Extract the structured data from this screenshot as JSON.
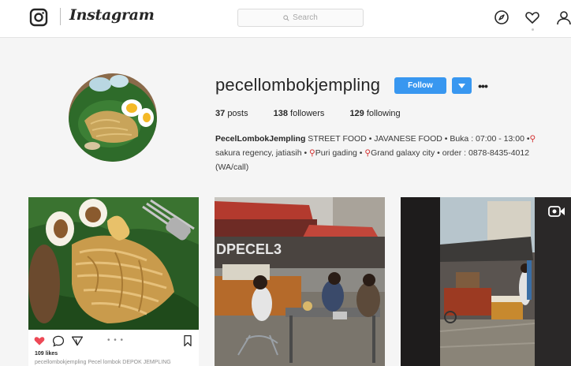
{
  "header": {
    "wordmark": "Instagram",
    "search_placeholder": "Search"
  },
  "profile": {
    "username": "pecellombokjempling",
    "follow_label": "Follow",
    "posts_count": "37",
    "posts_label": "posts",
    "followers_count": "138",
    "followers_label": "followers",
    "following_count": "129",
    "following_label": "following",
    "bio_name": "PecelLombokJempling",
    "bio_line1": "STREET FOOD • JAVANESE FOOD • Buka : 07:00 - 13:00 •",
    "bio_line2a": "sakura regency, jatiasih •",
    "bio_line2b": "Puri gading •",
    "bio_line2c": "Grand galaxy city • order : 0878-8435-4012",
    "bio_line3": "(WA/call)"
  },
  "posts": [
    {
      "sign_text": "",
      "likes": "109 likes",
      "caption": "pecellombokjempling Pecel lombok DEPOK JEMPLING"
    },
    {
      "sign_text": "DPECEL3"
    },
    {
      "video_badge": "video-camera-icon"
    }
  ],
  "colors": {
    "accent": "#3897f0",
    "heart": "#ed4956",
    "pin": "#d32f2f"
  },
  "icons": [
    "instagram-glyph-icon",
    "search-icon",
    "explore-compass-icon",
    "heart-icon",
    "user-icon",
    "chevron-down-icon",
    "like-heart-icon",
    "comment-icon",
    "share-icon",
    "bookmark-icon",
    "location-pin-icon",
    "video-camera-icon"
  ]
}
